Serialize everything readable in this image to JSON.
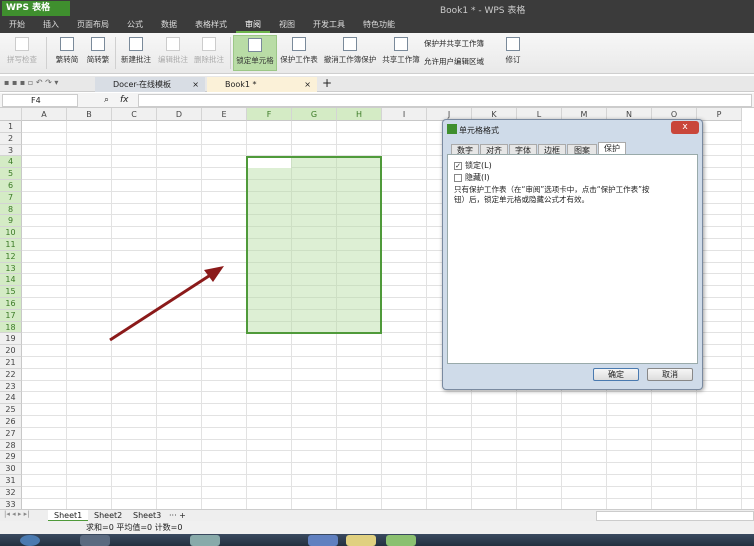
{
  "app": {
    "logo": "WPS 表格",
    "title": "Book1 * - WPS 表格"
  },
  "menu": [
    "开始",
    "插入",
    "页面布局",
    "公式",
    "数据",
    "表格样式",
    "审阅",
    "视图",
    "开发工具",
    "特色功能"
  ],
  "menu_active": 6,
  "ribbon": {
    "spell": "拼写检查",
    "trad_simp": "繁转简",
    "simp_trad": "简转繁",
    "new_comment": "新建批注",
    "edit_comment": "编辑批注",
    "delete_comment": "删除批注",
    "lock_cell": "锁定单元格",
    "protect_sheet": "保护工作表",
    "unprotect_book": "撤消工作簿保护",
    "share_book": "共享工作簿",
    "protect_share": "保护并共享工作簿",
    "allow_edit": "允许用户编辑区域",
    "revise": "修订"
  },
  "tabs": [
    {
      "label": "Docer-在线模板"
    },
    {
      "label": "Book1 *"
    }
  ],
  "formula": {
    "cell": "F4",
    "fx": "fx",
    "value": ""
  },
  "columns": [
    "A",
    "B",
    "C",
    "D",
    "E",
    "F",
    "G",
    "H",
    "I",
    "J",
    "K",
    "L",
    "M",
    "N",
    "O",
    "P"
  ],
  "rows": 33,
  "selection": "F4:H18",
  "sheets": [
    "Sheet1",
    "Sheet2",
    "Sheet3"
  ],
  "sheet_more": "··· +",
  "status": "求和=0  平均值=0  计数=0",
  "dialog": {
    "title": "单元格格式",
    "tabs": [
      "数字",
      "对齐",
      "字体",
      "边框",
      "图案",
      "保护"
    ],
    "active_tab": 5,
    "lock_label": "锁定(L)",
    "lock_checked": true,
    "hide_label": "隐藏(I)",
    "hide_checked": false,
    "note": "只有保护工作表（在“审阅”选项卡中，点击“保护工作表”按钮）后，锁定单元格或隐藏公式才有效。",
    "ok": "确定",
    "cancel": "取消",
    "close": "x"
  },
  "colors": {
    "accent": "#4f9a3a",
    "selection": "#d4ebc5",
    "arrow": "#8b1a1a",
    "titlebar": "#3b3b3b"
  }
}
